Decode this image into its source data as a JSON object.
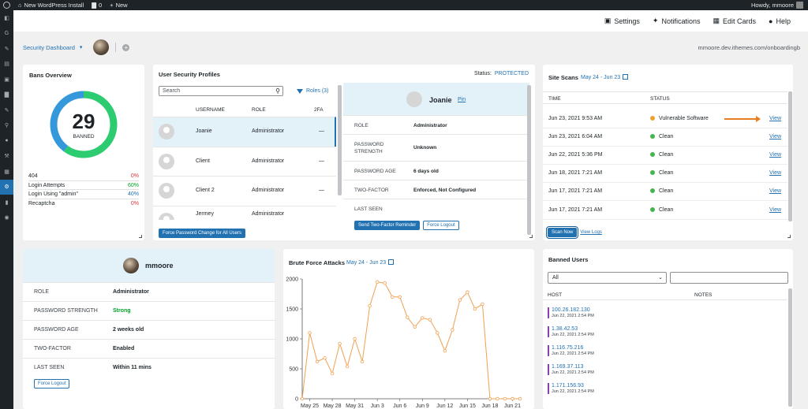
{
  "adminbar": {
    "site_name": "New WordPress Install",
    "comments_count": "0",
    "new_label": "New",
    "howdy": "Howdy, mmoore"
  },
  "toolbar": {
    "settings": "Settings",
    "notifications": "Notifications",
    "edit_cards": "Edit Cards",
    "help": "Help"
  },
  "dashboard": {
    "selector": "Security Dashboard",
    "site_url": "mmoore.dev.ithemes.com/onboardingb"
  },
  "bans": {
    "title": "Bans Overview",
    "count": "29",
    "count_label": "BANNED",
    "stats": [
      {
        "label": "404",
        "value": "0%",
        "fraction": 0.0
      },
      {
        "label": "Login Attempts",
        "value": "60%",
        "fraction": 0.6
      },
      {
        "label": "Login Using \"admin\"",
        "value": "40%",
        "fraction": 0.4
      },
      {
        "label": "Recaptcha",
        "value": "0%",
        "fraction": 0.0
      }
    ]
  },
  "usp": {
    "title": "User Security Profiles",
    "status_label": "Status:",
    "status_value": "PROTECTED",
    "search_placeholder": "Search",
    "roles": "Roles (3)",
    "columns": {
      "username": "USERNAME",
      "role": "ROLE",
      "twofa": "2FA"
    },
    "users": [
      {
        "username": "Joanie",
        "role": "Administrator",
        "twofa": "—"
      },
      {
        "username": "Client",
        "role": "Administrator",
        "twofa": "—"
      },
      {
        "username": "Client 2",
        "role": "Administrator",
        "twofa": "—"
      },
      {
        "username": "Jermey",
        "role": "Administrator",
        "twofa": "—"
      }
    ],
    "force_pw_button": "Force Password Change for All Users",
    "detail": {
      "name": "Joanie",
      "pin": "Pin",
      "rows": [
        {
          "key": "ROLE",
          "value": "Administrator"
        },
        {
          "key": "PASSWORD STRENGTH",
          "value": "Unknown"
        },
        {
          "key": "PASSWORD AGE",
          "value": "6 days old"
        },
        {
          "key": "TWO-FACTOR",
          "value": "Enforced, Not Configured"
        },
        {
          "key": "LAST SEEN",
          "value": ""
        }
      ],
      "reminder_button": "Send Two-Factor Reminder",
      "logout_button": "Force Logout"
    }
  },
  "scans": {
    "title": "Site Scans",
    "range": "May 24 - Jun 23",
    "columns": {
      "time": "TIME",
      "status": "STATUS"
    },
    "rows": [
      {
        "time": "Jun 23, 2021 9:53 AM",
        "status": "Vulnerable Software",
        "color": "#f0a030",
        "view": "View"
      },
      {
        "time": "Jun 23, 2021 6:04 AM",
        "status": "Clean",
        "color": "#46b450",
        "view": "View"
      },
      {
        "time": "Jun 22, 2021 5:36 PM",
        "status": "Clean",
        "color": "#46b450",
        "view": "View"
      },
      {
        "time": "Jun 18, 2021 7:21 AM",
        "status": "Clean",
        "color": "#46b450",
        "view": "View"
      },
      {
        "time": "Jun 17, 2021 7:21 AM",
        "status": "Clean",
        "color": "#46b450",
        "view": "View"
      },
      {
        "time": "Jun 17, 2021 7:21 AM",
        "status": "Clean",
        "color": "#46b450",
        "view": "View"
      }
    ],
    "scan_button": "Scan Now",
    "logs_link": "View Logs"
  },
  "profile": {
    "name": "mmoore",
    "rows": [
      {
        "key": "ROLE",
        "value": "Administrator",
        "color": "#1d2327"
      },
      {
        "key": "PASSWORD STRENGTH",
        "value": "Strong",
        "color": "#00a32a"
      },
      {
        "key": "PASSWORD AGE",
        "value": "2 weeks old",
        "color": "#1d2327"
      },
      {
        "key": "TWO-FACTOR",
        "value": "Enabled",
        "color": "#1d2327"
      },
      {
        "key": "LAST SEEN",
        "value": "Within 11 mins",
        "color": "#1d2327"
      }
    ],
    "logout_button": "Force Logout"
  },
  "brute": {
    "title": "Brute Force Attacks",
    "range": "May 24 - Jun 23"
  },
  "chart_data": {
    "type": "line",
    "title": "Brute Force Attacks",
    "color": "#f0a050",
    "ylim": [
      0,
      2000
    ],
    "yticks": [
      0,
      500,
      1000,
      1500,
      2000
    ],
    "xticks": [
      "May 25",
      "May 28",
      "May 31",
      "Jun 3",
      "Jun 6",
      "Jun 9",
      "Jun 12",
      "Jun 15",
      "Jun 18",
      "Jun 21"
    ],
    "x": [
      "May 24",
      "May 25",
      "May 26",
      "May 27",
      "May 28",
      "May 29",
      "May 30",
      "May 31",
      "Jun 1",
      "Jun 2",
      "Jun 3",
      "Jun 4",
      "Jun 5",
      "Jun 6",
      "Jun 7",
      "Jun 8",
      "Jun 9",
      "Jun 10",
      "Jun 11",
      "Jun 12",
      "Jun 13",
      "Jun 14",
      "Jun 15",
      "Jun 16",
      "Jun 17",
      "Jun 18",
      "Jun 19",
      "Jun 20",
      "Jun 21",
      "Jun 22"
    ],
    "values": [
      0,
      1100,
      620,
      680,
      420,
      920,
      540,
      1000,
      620,
      1550,
      1950,
      1930,
      1700,
      1700,
      1360,
      1200,
      1350,
      1320,
      1100,
      800,
      1150,
      1650,
      1780,
      1500,
      1580,
      0,
      0,
      0,
      0,
      0
    ]
  },
  "banned": {
    "title": "Banned Users",
    "select_value": "All",
    "columns": {
      "host": "HOST",
      "notes": "NOTES"
    },
    "rows": [
      {
        "ip": "100.26.182.130",
        "date": "Jun 22, 2021 2:54 PM"
      },
      {
        "ip": "1.38.42.53",
        "date": "Jun 22, 2021 2:54 PM"
      },
      {
        "ip": "1.116.75.216",
        "date": "Jun 22, 2021 2:54 PM"
      },
      {
        "ip": "1.169.37.113",
        "date": "Jun 22, 2021 2:54 PM"
      },
      {
        "ip": "1.171.156.93",
        "date": "Jun 22, 2021 2:54 PM"
      }
    ]
  }
}
